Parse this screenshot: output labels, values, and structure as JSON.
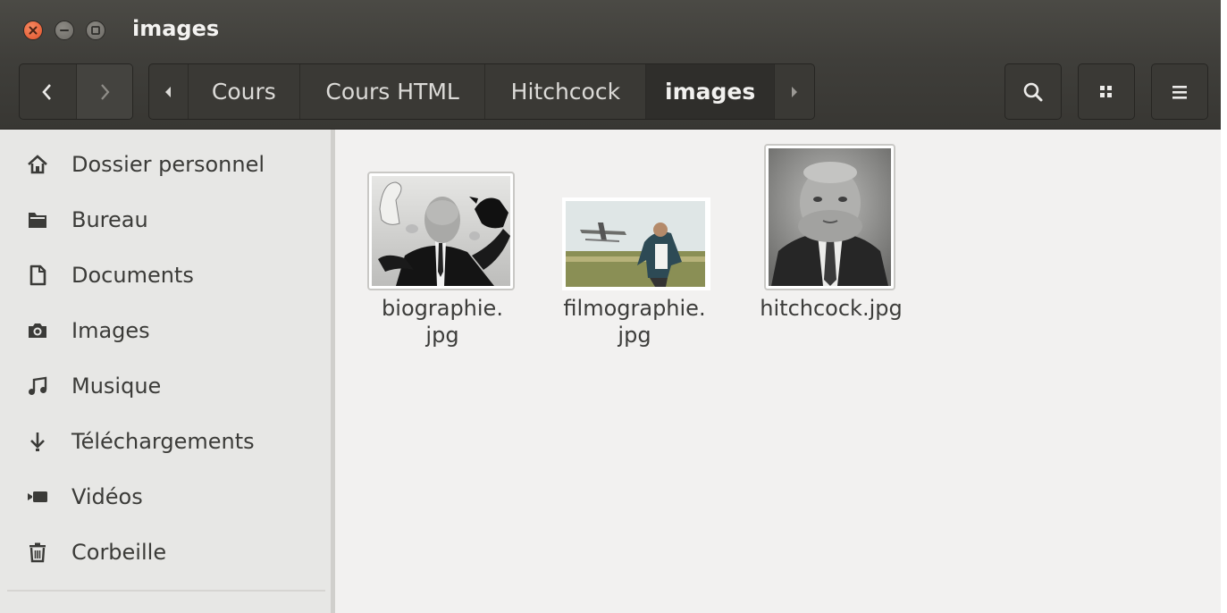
{
  "window": {
    "title": "images",
    "controls": {
      "close_icon": "close-icon",
      "minimize_icon": "minimize-icon",
      "maximize_icon": "maximize-icon"
    }
  },
  "toolbar": {
    "back_icon": "chevron-left-icon",
    "forward_icon": "chevron-right-icon",
    "breadcrumb": [
      {
        "label": "Cours"
      },
      {
        "label": "Cours HTML"
      },
      {
        "label": "Hitchcock"
      },
      {
        "label": "images",
        "active": true
      }
    ],
    "search_icon": "search-icon",
    "view_icon": "grid-view-icon",
    "menu_icon": "hamburger-menu-icon"
  },
  "sidebar": {
    "items": [
      {
        "label": "Dossier personnel",
        "icon": "home-icon"
      },
      {
        "label": "Bureau",
        "icon": "folder-icon"
      },
      {
        "label": "Documents",
        "icon": "document-icon"
      },
      {
        "label": "Images",
        "icon": "camera-icon"
      },
      {
        "label": "Musique",
        "icon": "music-icon"
      },
      {
        "label": "Téléchargements",
        "icon": "download-icon"
      },
      {
        "label": "Vidéos",
        "icon": "video-icon"
      },
      {
        "label": "Corbeille",
        "icon": "trash-icon"
      }
    ]
  },
  "files": [
    {
      "name_line1": "biographie.",
      "name_line2": "jpg"
    },
    {
      "name_line1": "filmographie.",
      "name_line2": "jpg"
    },
    {
      "name_line1": "hitchcock.jpg"
    }
  ],
  "colors": {
    "titlebar": "#3f3e3a",
    "close_button": "#e2522a",
    "sidebar_bg": "#e7e7e5",
    "content_bg": "#f2f1f0"
  }
}
